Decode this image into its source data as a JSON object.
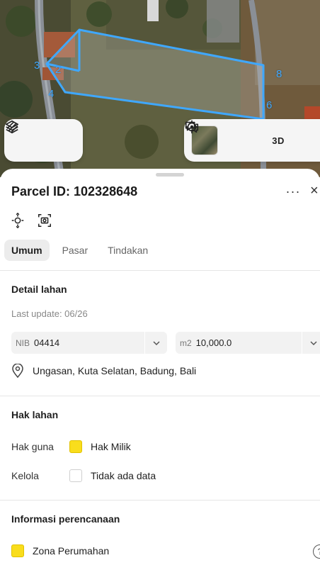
{
  "map": {
    "parcel_points": [
      "2",
      "3",
      "4",
      "6",
      "8"
    ],
    "parcel_color": "#3fa8ff",
    "controls_left": [
      {
        "icon": "layers-icon"
      },
      {
        "icon": "draw-icon"
      }
    ],
    "controls_right": [
      {
        "icon": "satellite-thumbnail"
      },
      {
        "icon": "locate-icon"
      },
      {
        "label": "3D"
      },
      {
        "icon": "feedback-icon"
      }
    ]
  },
  "parcel": {
    "title": "Parcel ID: 102328648",
    "more": "···",
    "close": "×"
  },
  "tabs": [
    "Umum",
    "Pasar",
    "Tindakan"
  ],
  "detail": {
    "section_title": "Detail lahan",
    "last_update": "Last update: 06/26",
    "nib_prefix": "NIB",
    "nib_value": "04414",
    "area_prefix": "m2",
    "area_value": "10,000.0",
    "location": "Ungasan, Kuta Selatan, Badung, Bali"
  },
  "hak": {
    "section_title": "Hak lahan",
    "rows": [
      {
        "label": "Hak guna",
        "value": "Hak Milik",
        "swatch": "#f9dd1c"
      },
      {
        "label": "Kelola",
        "value": "Tidak ada data",
        "swatch": "#ffffff"
      }
    ]
  },
  "planning": {
    "section_title": "Informasi perencanaan",
    "zone": "Zona Perumahan",
    "zone_color": "#f9dd1c",
    "info": "?"
  }
}
